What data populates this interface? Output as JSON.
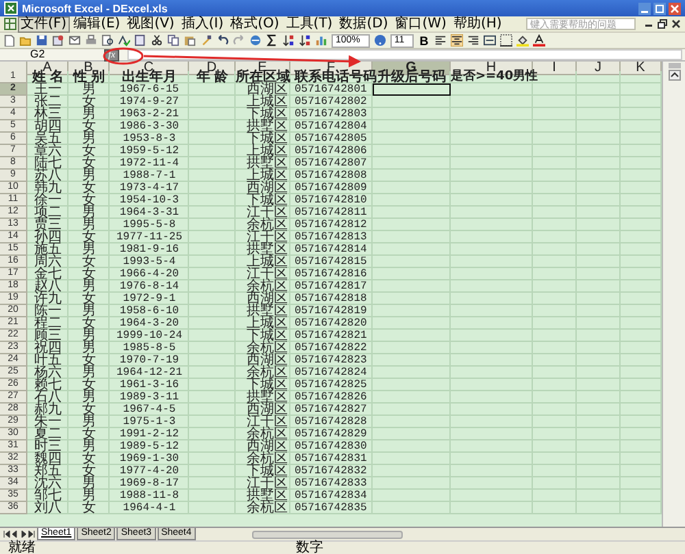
{
  "window": {
    "title": "Microsoft Excel - DExcel.xls"
  },
  "menu": [
    {
      "label": "文件(F)",
      "selected": true
    },
    {
      "label": "编辑(E)",
      "selected": false
    },
    {
      "label": "视图(V)",
      "selected": false
    },
    {
      "label": "插入(I)",
      "selected": false
    },
    {
      "label": "格式(O)",
      "selected": false
    },
    {
      "label": "工具(T)",
      "selected": false
    },
    {
      "label": "数据(D)",
      "selected": false
    },
    {
      "label": "窗口(W)",
      "selected": false
    },
    {
      "label": "帮助(H)",
      "selected": false
    }
  ],
  "help_box": {
    "placeholder": "键入需要帮助的问题"
  },
  "toolbar": {
    "zoom": "100%",
    "font_size": "11",
    "bold_label": "B"
  },
  "formula_bar": {
    "name_box": "G2",
    "function_button": "fx"
  },
  "columns": [
    {
      "label": "A",
      "selected": false
    },
    {
      "label": "B",
      "selected": false
    },
    {
      "label": "C",
      "selected": false
    },
    {
      "label": "D",
      "selected": false
    },
    {
      "label": "E",
      "selected": false
    },
    {
      "label": "F",
      "selected": false
    },
    {
      "label": "G",
      "selected": true
    },
    {
      "label": "H",
      "selected": false
    },
    {
      "label": "I",
      "selected": false
    },
    {
      "label": "J",
      "selected": false
    },
    {
      "label": "K",
      "selected": false
    }
  ],
  "header_row": {
    "number": "1",
    "cells": [
      "姓 名",
      "性 别",
      "出生年月",
      "年 龄",
      "所在区域",
      "联系电话号码",
      "升级后号码",
      "是否>=40男性"
    ]
  },
  "rows": [
    {
      "number": "2",
      "selected": true,
      "name": "王一",
      "gender": "男",
      "birth": "1967-6-15",
      "district": "西湖区",
      "phone": "05716742801"
    },
    {
      "number": "3",
      "selected": false,
      "name": "张二",
      "gender": "女",
      "birth": "1974-9-27",
      "district": "上城区",
      "phone": "05716742802"
    },
    {
      "number": "4",
      "selected": false,
      "name": "林三",
      "gender": "男",
      "birth": "1963-2-21",
      "district": "下城区",
      "phone": "05716742803"
    },
    {
      "number": "5",
      "selected": false,
      "name": "胡四",
      "gender": "女",
      "birth": "1986-3-30",
      "district": "拱墅区",
      "phone": "05716742804"
    },
    {
      "number": "6",
      "selected": false,
      "name": "吴五",
      "gender": "男",
      "birth": "1953-8-3",
      "district": "下城区",
      "phone": "05716742805"
    },
    {
      "number": "7",
      "selected": false,
      "name": "章六",
      "gender": "女",
      "birth": "1959-5-12",
      "district": "上城区",
      "phone": "05716742806"
    },
    {
      "number": "8",
      "selected": false,
      "name": "陆七",
      "gender": "女",
      "birth": "1972-11-4",
      "district": "拱墅区",
      "phone": "05716742807"
    },
    {
      "number": "9",
      "selected": false,
      "name": "苏八",
      "gender": "男",
      "birth": "1988-7-1",
      "district": "上城区",
      "phone": "05716742808"
    },
    {
      "number": "10",
      "selected": false,
      "name": "韩九",
      "gender": "女",
      "birth": "1973-4-17",
      "district": "西湖区",
      "phone": "05716742809"
    },
    {
      "number": "11",
      "selected": false,
      "name": "徐一",
      "gender": "女",
      "birth": "1954-10-3",
      "district": "下城区",
      "phone": "05716742810"
    },
    {
      "number": "12",
      "selected": false,
      "name": "项二",
      "gender": "男",
      "birth": "1964-3-31",
      "district": "江干区",
      "phone": "05716742811"
    },
    {
      "number": "13",
      "selected": false,
      "name": "贾三",
      "gender": "男",
      "birth": "1995-5-8",
      "district": "余杭区",
      "phone": "05716742812"
    },
    {
      "number": "14",
      "selected": false,
      "name": "孙四",
      "gender": "女",
      "birth": "1977-11-25",
      "district": "江干区",
      "phone": "05716742813"
    },
    {
      "number": "15",
      "selected": false,
      "name": "施五",
      "gender": "男",
      "birth": "1981-9-16",
      "district": "拱墅区",
      "phone": "05716742814"
    },
    {
      "number": "16",
      "selected": false,
      "name": "周六",
      "gender": "女",
      "birth": "1993-5-4",
      "district": "上城区",
      "phone": "05716742815"
    },
    {
      "number": "17",
      "selected": false,
      "name": "金七",
      "gender": "女",
      "birth": "1966-4-20",
      "district": "江干区",
      "phone": "05716742816"
    },
    {
      "number": "18",
      "selected": false,
      "name": "赵八",
      "gender": "男",
      "birth": "1976-8-14",
      "district": "余杭区",
      "phone": "05716742817"
    },
    {
      "number": "19",
      "selected": false,
      "name": "许九",
      "gender": "女",
      "birth": "1972-9-1",
      "district": "西湖区",
      "phone": "05716742818"
    },
    {
      "number": "20",
      "selected": false,
      "name": "陈一",
      "gender": "男",
      "birth": "1958-6-10",
      "district": "拱墅区",
      "phone": "05716742819"
    },
    {
      "number": "21",
      "selected": false,
      "name": "程二",
      "gender": "女",
      "birth": "1964-3-20",
      "district": "上城区",
      "phone": "05716742820"
    },
    {
      "number": "22",
      "selected": false,
      "name": "顾三",
      "gender": "男",
      "birth": "1999-10-24",
      "district": "下城区",
      "phone": "05716742821"
    },
    {
      "number": "23",
      "selected": false,
      "name": "祝四",
      "gender": "男",
      "birth": "1985-8-5",
      "district": "余杭区",
      "phone": "05716742822"
    },
    {
      "number": "24",
      "selected": false,
      "name": "叶五",
      "gender": "女",
      "birth": "1970-7-19",
      "district": "西湖区",
      "phone": "05716742823"
    },
    {
      "number": "25",
      "selected": false,
      "name": "杨六",
      "gender": "男",
      "birth": "1964-12-21",
      "district": "余杭区",
      "phone": "05716742824"
    },
    {
      "number": "26",
      "selected": false,
      "name": "赖七",
      "gender": "女",
      "birth": "1961-3-16",
      "district": "下城区",
      "phone": "05716742825"
    },
    {
      "number": "27",
      "selected": false,
      "name": "石八",
      "gender": "男",
      "birth": "1989-3-11",
      "district": "拱墅区",
      "phone": "05716742826"
    },
    {
      "number": "28",
      "selected": false,
      "name": "郝九",
      "gender": "女",
      "birth": "1967-4-5",
      "district": "西湖区",
      "phone": "05716742827"
    },
    {
      "number": "29",
      "selected": false,
      "name": "朱一",
      "gender": "男",
      "birth": "1975-1-3",
      "district": "江干区",
      "phone": "05716742828"
    },
    {
      "number": "30",
      "selected": false,
      "name": "夏二",
      "gender": "女",
      "birth": "1991-2-12",
      "district": "余杭区",
      "phone": "05716742829"
    },
    {
      "number": "31",
      "selected": false,
      "name": "时三",
      "gender": "男",
      "birth": "1989-5-12",
      "district": "西湖区",
      "phone": "05716742830"
    },
    {
      "number": "32",
      "selected": false,
      "name": "魏四",
      "gender": "女",
      "birth": "1969-1-30",
      "district": "余杭区",
      "phone": "05716742831"
    },
    {
      "number": "33",
      "selected": false,
      "name": "郑五",
      "gender": "女",
      "birth": "1977-4-20",
      "district": "下城区",
      "phone": "05716742832"
    },
    {
      "number": "34",
      "selected": false,
      "name": "沈六",
      "gender": "男",
      "birth": "1969-8-17",
      "district": "江干区",
      "phone": "05716742833"
    },
    {
      "number": "35",
      "selected": false,
      "name": "邹七",
      "gender": "男",
      "birth": "1988-11-8",
      "district": "拱墅区",
      "phone": "05716742834"
    },
    {
      "number": "36",
      "selected": false,
      "name": "刘八",
      "gender": "女",
      "birth": "1964-4-1",
      "district": "余杭区",
      "phone": "05716742835"
    }
  ],
  "sheet_tabs": [
    {
      "label": "Sheet1",
      "selected": true
    },
    {
      "label": "Sheet2",
      "selected": false
    },
    {
      "label": "Sheet3",
      "selected": false
    },
    {
      "label": "Sheet4",
      "selected": false
    }
  ],
  "status_bar": {
    "left": "就绪",
    "right": "数字"
  }
}
